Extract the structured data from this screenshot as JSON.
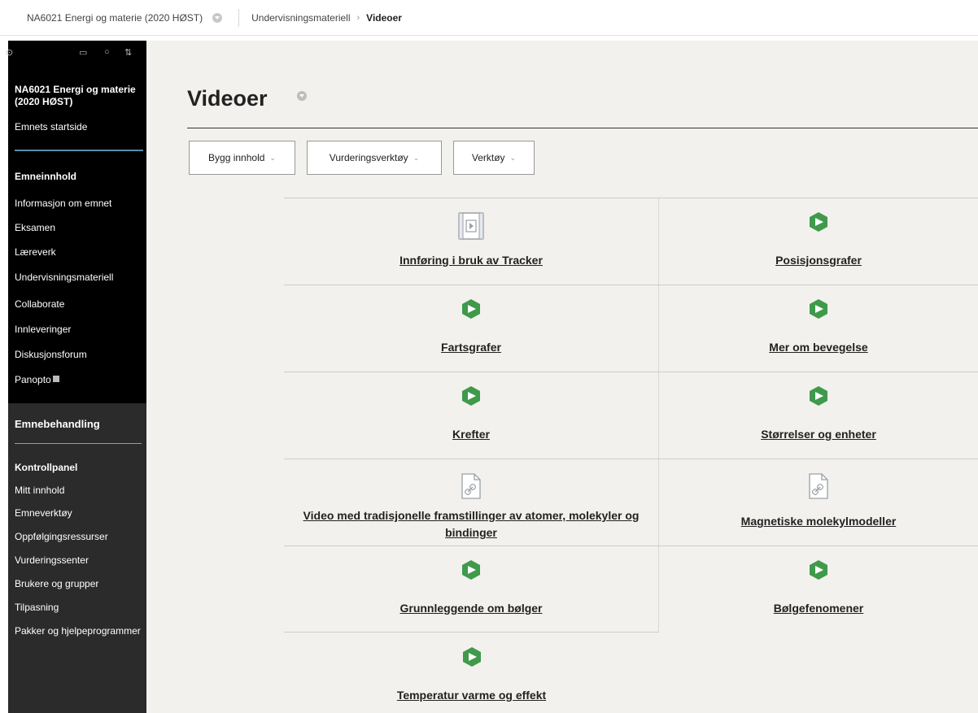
{
  "topbar": {
    "course": "NA6021 Energi og materie (2020 HØST)",
    "crumb_parent": "Undervisningsmateriell",
    "crumb_separator": "›",
    "crumb_current": "Videoer"
  },
  "sidebar": {
    "course_title": "NA6021 Energi og materie (2020 HØST)",
    "home_link": "Emnets startside",
    "content_heading": "Emneinnhold",
    "items": [
      {
        "label": "Informasjon om emnet"
      },
      {
        "label": "Eksamen"
      },
      {
        "label": "Læreverk"
      },
      {
        "label": "Undervisningsmateriell"
      },
      {
        "label": "Collaborate"
      },
      {
        "label": "Innleveringer"
      },
      {
        "label": "Diskusjonsforum"
      },
      {
        "label": "Panopto"
      }
    ],
    "admin": {
      "heading": "Emnebehandling",
      "panel_heading": "Kontrollpanel",
      "items": [
        {
          "label": "Mitt innhold"
        },
        {
          "label": "Emneverktøy"
        },
        {
          "label": "Oppfølgingsressurser"
        },
        {
          "label": "Vurderingssenter"
        },
        {
          "label": "Brukere og grupper"
        },
        {
          "label": "Tilpasning"
        },
        {
          "label": "Pakker og hjelpeprogrammer"
        }
      ]
    }
  },
  "main": {
    "title": "Videoer",
    "buttons": {
      "build": "Bygg innhold",
      "assessment": "Vurderingsverktøy",
      "tools": "Verktøy",
      "chevron": "⌄"
    },
    "items": [
      {
        "label": "Innføring i bruk av Tracker",
        "icon": "video-file-icon"
      },
      {
        "label": "Posisjonsgrafer",
        "icon": "panopto-icon"
      },
      {
        "label": "Fartsgrafer",
        "icon": "panopto-icon"
      },
      {
        "label": "Mer om bevegelse",
        "icon": "panopto-icon"
      },
      {
        "label": "Krefter",
        "icon": "panopto-icon"
      },
      {
        "label": "Størrelser og enheter",
        "icon": "panopto-icon"
      },
      {
        "label": "Video med tradisjonelle framstillinger av atomer, molekyler og bindinger",
        "icon": "link-file-icon"
      },
      {
        "label": "Magnetiske molekylmodeller",
        "icon": "link-file-icon"
      },
      {
        "label": "Grunnleggende om bølger",
        "icon": "panopto-icon"
      },
      {
        "label": "Bølgefenomener",
        "icon": "panopto-icon"
      },
      {
        "label": "Temperatur varme og effekt",
        "icon": "panopto-icon"
      }
    ]
  },
  "colors": {
    "panopto_green": "#3f9a4b",
    "sidebar_bg": "#000000",
    "admin_bg": "#2b2b2b",
    "main_bg": "#f2f1ee"
  }
}
